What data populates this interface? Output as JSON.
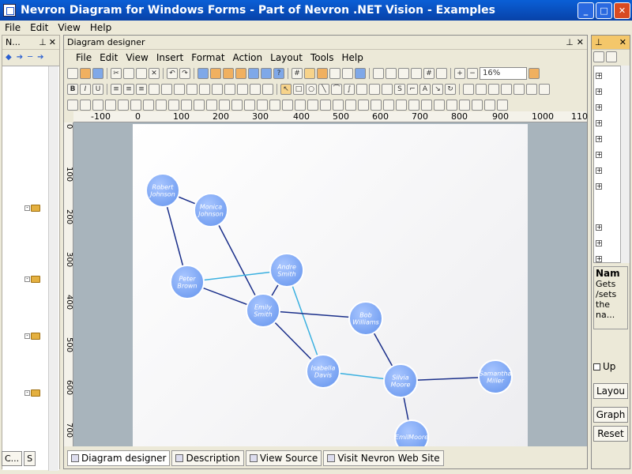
{
  "window": {
    "title": "Nevron Diagram for Windows Forms - Part of Nevron .NET Vision - Examples"
  },
  "main_menu": [
    "File",
    "Edit",
    "View",
    "Help"
  ],
  "left_panel": {
    "title": "N...",
    "tabs": [
      "C...",
      "S"
    ]
  },
  "designer": {
    "title": "Diagram designer",
    "menu": [
      "File",
      "Edit",
      "View",
      "Insert",
      "Format",
      "Action",
      "Layout",
      "Tools",
      "Help"
    ],
    "zoom": "16%",
    "ruler_h": [
      "-100",
      "0",
      "100",
      "200",
      "300",
      "400",
      "500",
      "600",
      "700",
      "800",
      "900",
      "1000",
      "110"
    ],
    "ruler_v": [
      "0",
      "100",
      "200",
      "300",
      "400",
      "500",
      "600",
      "700"
    ]
  },
  "diagram": {
    "nodes": [
      {
        "id": "robert",
        "label": [
          "Robert",
          "Johnson"
        ]
      },
      {
        "id": "monica",
        "label": [
          "Monica",
          "Johnson"
        ]
      },
      {
        "id": "peter",
        "label": [
          "Peter",
          "Brown"
        ]
      },
      {
        "id": "andre",
        "label": [
          "Andre",
          "Smith"
        ]
      },
      {
        "id": "emily",
        "label": [
          "Emily",
          "Smith"
        ]
      },
      {
        "id": "bob",
        "label": [
          "Bob",
          "Williams"
        ]
      },
      {
        "id": "isabella",
        "label": [
          "Isabella",
          "Davis"
        ]
      },
      {
        "id": "silvia",
        "label": [
          "Silvia",
          "Moore"
        ]
      },
      {
        "id": "samantha",
        "label": [
          "Samantha",
          "Miller"
        ]
      },
      {
        "id": "emil",
        "label": [
          "EmilMoore"
        ]
      }
    ],
    "edges": [
      {
        "from": "robert",
        "to": "monica",
        "color": "#1a2f8a"
      },
      {
        "from": "robert",
        "to": "peter",
        "color": "#1a2f8a"
      },
      {
        "from": "monica",
        "to": "emily",
        "color": "#1a2f8a"
      },
      {
        "from": "peter",
        "to": "andre",
        "color": "#3ab0e0"
      },
      {
        "from": "peter",
        "to": "emily",
        "color": "#1a2f8a"
      },
      {
        "from": "andre",
        "to": "emily",
        "color": "#1a2f8a"
      },
      {
        "from": "andre",
        "to": "isabella",
        "color": "#3ab0e0"
      },
      {
        "from": "emily",
        "to": "bob",
        "color": "#1a2f8a"
      },
      {
        "from": "emily",
        "to": "isabella",
        "color": "#1a2f8a"
      },
      {
        "from": "bob",
        "to": "silvia",
        "color": "#1a2f8a"
      },
      {
        "from": "isabella",
        "to": "silvia",
        "color": "#3ab0e0"
      },
      {
        "from": "silvia",
        "to": "samantha",
        "color": "#1a2f8a"
      },
      {
        "from": "silvia",
        "to": "emil",
        "color": "#1a2f8a"
      }
    ]
  },
  "bottom_tabs": [
    "Diagram designer",
    "Description",
    "View Source",
    "Visit Nevron Web Site"
  ],
  "right_panel": {
    "desc_title": "Nam",
    "desc_text": "Gets /sets the na...",
    "checkbox_label": "Up",
    "buttons": [
      "Layou",
      "Graph",
      "Reset"
    ]
  },
  "colors": {
    "node_fill": "#6f9cf0",
    "edge_dark": "#1a2f8a",
    "edge_light": "#3ab0e0"
  }
}
